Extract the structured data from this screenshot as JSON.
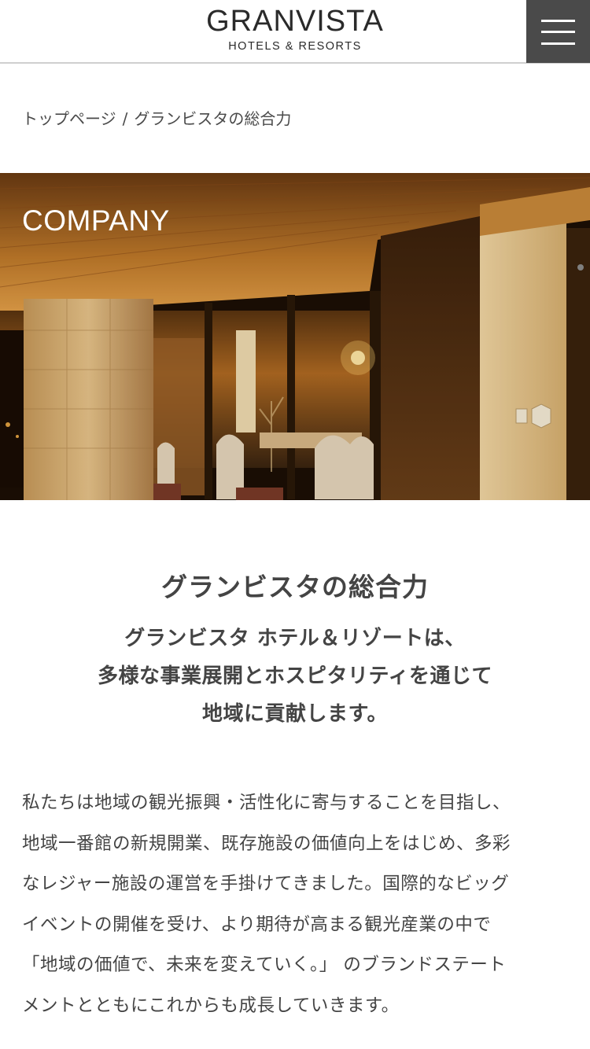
{
  "header": {
    "logo_main": "GRANVISTA",
    "logo_sub": "HOTELS & RESORTS",
    "menu_icon": "hamburger-menu-icon"
  },
  "breadcrumb": {
    "home": "トップページ",
    "separator": "/",
    "current": "グランビスタの総合力"
  },
  "hero": {
    "label": "COMPANY"
  },
  "main": {
    "title": "グランビスタの総合力",
    "lead_lines": [
      "グランビスタ ホテル＆リゾートは、",
      "多様な事業展開とホスピタリティを通じて",
      "地域に貢献します。"
    ],
    "body_lines": [
      "私たちは地域の観光振興・活性化に寄与することを目指し、",
      "地域一番館の新規開業、既存施設の価値向上をはじめ、多彩",
      "なレジャー施設の運営を手掛けてきました。国際的なビッグ",
      "イベントの開催を受け、より期待が高まる観光産業の中で",
      "「地域の価値で、未来を変えていく。」 のブランドステート",
      "メントとともにこれからも成長していきます。"
    ]
  },
  "colors": {
    "menu_bg": "#4a4a4a",
    "text": "#444444",
    "hero_warm": "#c98a2e"
  }
}
